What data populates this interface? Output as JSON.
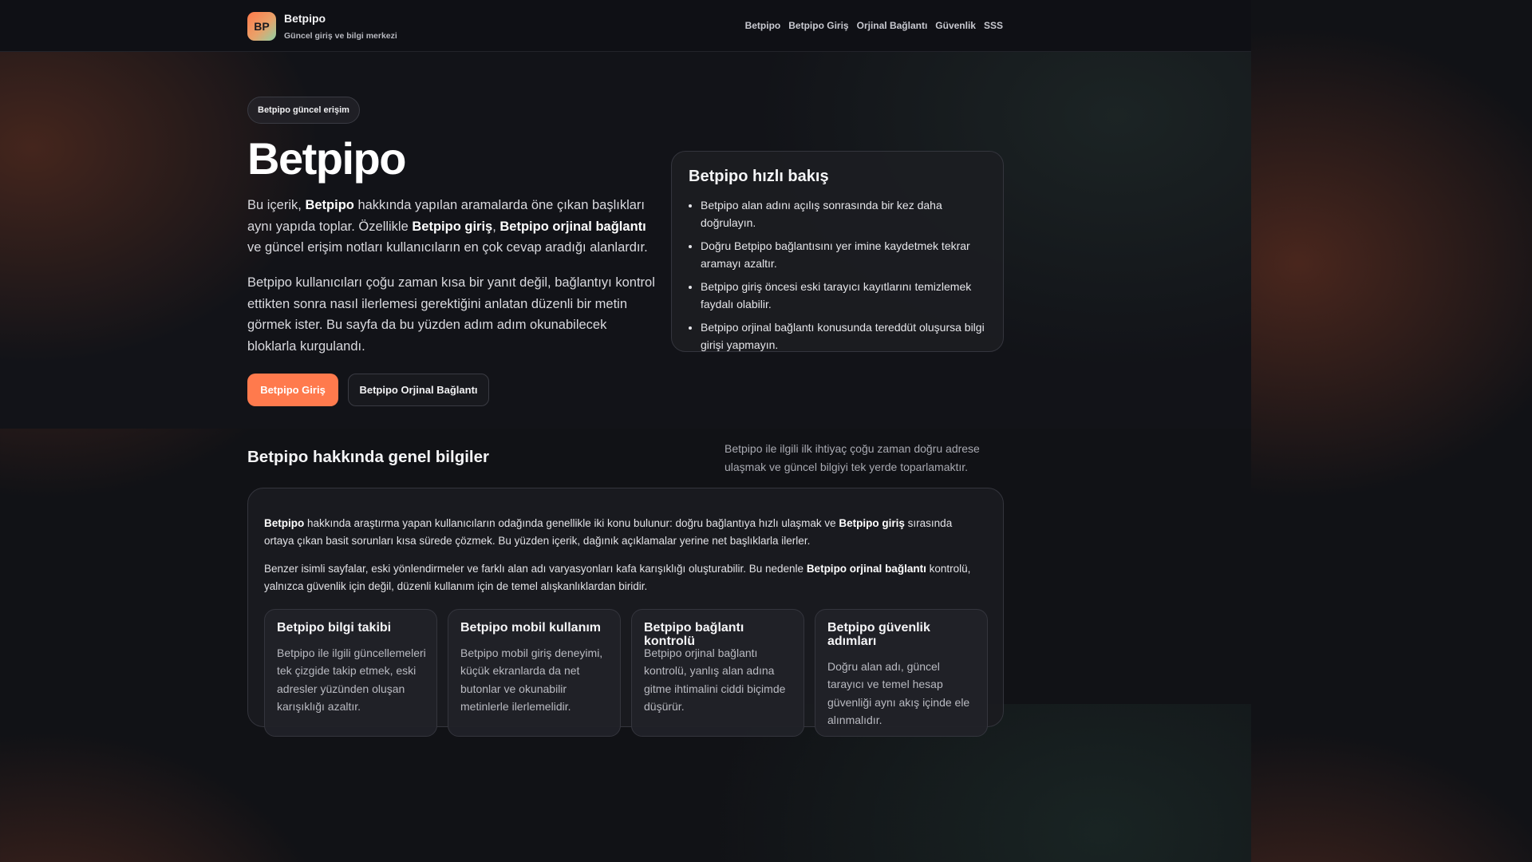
{
  "header": {
    "logo_text": "BP",
    "brand_name": "Betpipo",
    "brand_subtitle": "Güncel giriş ve bilgi merkezi",
    "nav": [
      "Betpipo",
      "Betpipo Giriş",
      "Orjinal Bağlantı",
      "Güvenlik",
      "SSS"
    ]
  },
  "hero": {
    "badge": "Betpipo güncel erişim",
    "title": "Betpipo",
    "p1": {
      "t1": "Bu içerik, ",
      "b1": "Betpipo",
      "t2": " hakkında yapılan aramalarda öne çıkan başlıkları aynı yapıda toplar. Özellikle ",
      "b2": "Betpipo giriş",
      "t3": ", ",
      "b3": "Betpipo orjinal bağlantı",
      "t4": " ve güncel erişim notları kullanıcıların en çok cevap aradığı alanlardır."
    },
    "p2": "Betpipo kullanıcıları çoğu zaman kısa bir yanıt değil, bağlantıyı kontrol ettikten sonra nasıl ilerlemesi gerektiğini anlatan düzenli bir metin görmek ister. Bu sayfa da bu yüzden adım adım okunabilecek bloklarla kurgulandı.",
    "primary_button": "Betpipo Giriş",
    "secondary_button": "Betpipo Orjinal Bağlantı"
  },
  "quick_overview": {
    "title": "Betpipo hızlı bakış",
    "items": [
      "Betpipo alan adını açılış sonrasında bir kez daha doğrulayın.",
      "Doğru Betpipo bağlantısını yer imine kaydetmek tekrar aramayı azaltır.",
      "Betpipo giriş öncesi eski tarayıcı kayıtlarını temizlemek faydalı olabilir.",
      "Betpipo orjinal bağlantı konusunda tereddüt oluşursa bilgi girişi yapmayın."
    ]
  },
  "general": {
    "title": "Betpipo hakkında genel bilgiler",
    "description": "Betpipo ile ilgili ilk ihtiyaç çoğu zaman doğru adrese ulaşmak ve güncel bilgiyi tek yerde toparlamaktır.",
    "p1": {
      "b1": "Betpipo",
      "t1": " hakkında araştırma yapan kullanıcıların odağında genellikle iki konu bulunur: doğru bağlantıya hızlı ulaşmak ve ",
      "b2": "Betpipo giriş",
      "t2": " sırasında ortaya çıkan basit sorunları kısa sürede çözmek. Bu yüzden içerik, dağınık açıklamalar yerine net başlıklarla ilerler."
    },
    "p2": {
      "t1": "Benzer isimli sayfalar, eski yönlendirmeler ve farklı alan adı varyasyonları kafa karışıklığı oluşturabilir. Bu nedenle ",
      "b1": "Betpipo orjinal bağlantı",
      "t2": " kontrolü, yalnızca güvenlik için değil, düzenli kullanım için de temel alışkanlıklardan biridir."
    },
    "cards": [
      {
        "title": "Betpipo bilgi takibi",
        "text": "Betpipo ile ilgili güncellemeleri tek çizgide takip etmek, eski adresler yüzünden oluşan karışıklığı azaltır."
      },
      {
        "title": "Betpipo mobil kullanım",
        "text": "Betpipo mobil giriş deneyimi, küçük ekranlarda da net butonlar ve okunabilir metinlerle ilerlemelidir."
      },
      {
        "title": "Betpipo bağlantı kontrolü",
        "text": "Betpipo orjinal bağlantı kontrolü, yanlış alan adına gitme ihtimalini ciddi biçimde düşürür."
      },
      {
        "title": "Betpipo güvenlik adımları",
        "text": "Doğru alan adı, güncel tarayıcı ve temel hesap güvenliği aynı akış içinde ele alınmalıdır."
      }
    ]
  },
  "colors": {
    "accent": "#ff7a4d",
    "background": "#111216",
    "card": "#1c1d22"
  }
}
